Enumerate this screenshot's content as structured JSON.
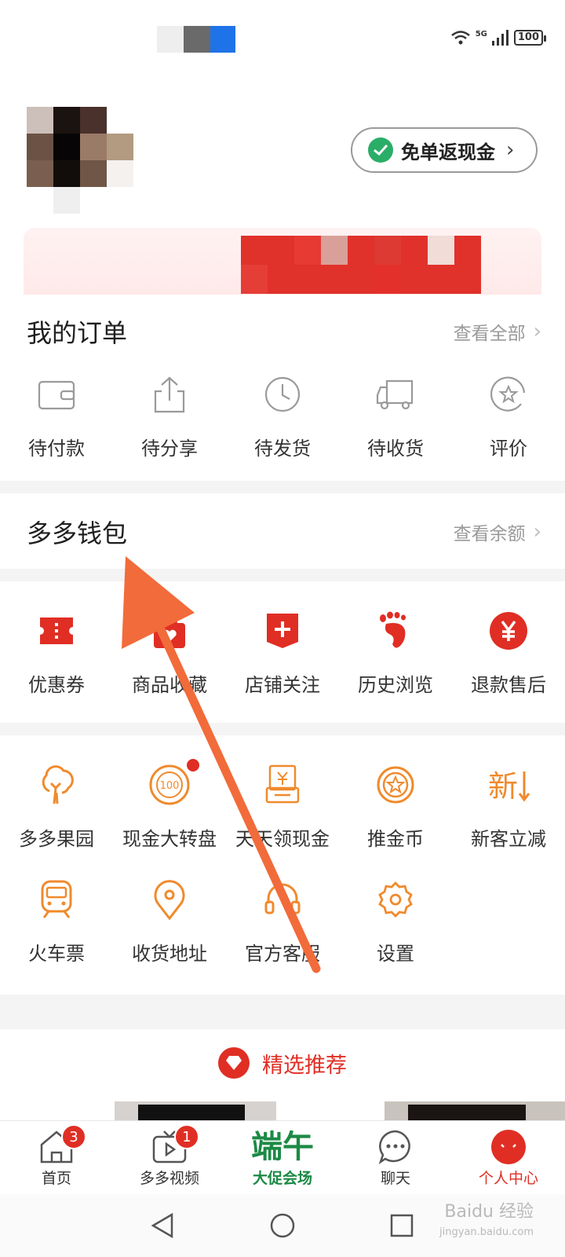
{
  "status_bar": {
    "network": "5G",
    "battery": "100"
  },
  "header": {
    "cashback_label": "免单返现金",
    "cashback_chevron": "›"
  },
  "orders": {
    "title": "我的订单",
    "view_all": "查看全部",
    "items": [
      {
        "label": "待付款",
        "icon": "wallet-icon"
      },
      {
        "label": "待分享",
        "icon": "share-icon"
      },
      {
        "label": "待发货",
        "icon": "clock-icon"
      },
      {
        "label": "待收货",
        "icon": "truck-icon"
      },
      {
        "label": "评价",
        "icon": "review-star-icon"
      }
    ]
  },
  "wallet": {
    "title": "多多钱包",
    "view_balance": "查看余额"
  },
  "services": [
    {
      "label": "优惠券",
      "icon": "coupon-icon"
    },
    {
      "label": "商品收藏",
      "icon": "favorite-bag-icon"
    },
    {
      "label": "店铺关注",
      "icon": "store-plus-icon"
    },
    {
      "label": "历史浏览",
      "icon": "footprint-icon"
    },
    {
      "label": "退款售后",
      "icon": "refund-yen-icon"
    }
  ],
  "tools_row1": [
    {
      "label": "多多果园",
      "icon": "tree-icon"
    },
    {
      "label": "现金大转盘",
      "icon": "wheel-icon",
      "dot": true
    },
    {
      "label": "天天领现金",
      "icon": "cash-card-icon"
    },
    {
      "label": "推金币",
      "icon": "coin-icon"
    },
    {
      "label": "新客立减",
      "icon": "new-discount-icon"
    }
  ],
  "tools_row2": [
    {
      "label": "火车票",
      "icon": "train-icon"
    },
    {
      "label": "收货地址",
      "icon": "location-icon"
    },
    {
      "label": "官方客服",
      "icon": "headset-icon"
    },
    {
      "label": "设置",
      "icon": "gear-icon"
    }
  ],
  "recommend": {
    "label": "精选推荐"
  },
  "nav": [
    {
      "label": "首页",
      "badge": "3"
    },
    {
      "label": "多多视频",
      "badge": "1"
    },
    {
      "label": "大促会场",
      "logo": "端午"
    },
    {
      "label": "聊天"
    },
    {
      "label": "个人中心"
    }
  ],
  "watermark": {
    "text": "Baidu 经验",
    "sub": "jingyan.baidu.com"
  },
  "colors": {
    "brand_red": "#e02e24",
    "tool_orange": "#f08a2c",
    "dragon_green": "#1c8a45",
    "annotation_arrow": "#f26b3a"
  }
}
